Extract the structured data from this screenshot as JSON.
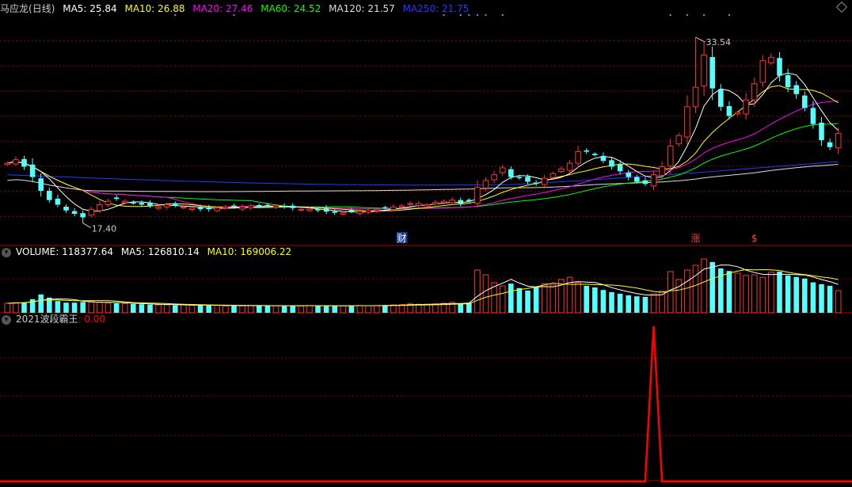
{
  "colors": {
    "up": "#ff3232",
    "down": "#54ffff",
    "grid": "#8b0000",
    "ma5": "#ffffff",
    "ma10": "#ffff00",
    "ma20": "#ff00ff",
    "ma60": "#00ff00",
    "ma120": "#dddddd",
    "ma250": "#1e3cff",
    "ind": "#ff0000",
    "label": "#cccccc"
  },
  "price_panel": {
    "stock_name": "马应龙",
    "period": "(日线)",
    "ma5": "MA5: 25.84",
    "ma10": "MA10: 26.88",
    "ma20": "MA20: 27.46",
    "ma60": "MA60: 24.52",
    "ma120": "MA120: 21.57",
    "ma250": "MA250: 21.75",
    "high_label": "33.54",
    "low_label": "17.40",
    "marker_cai": "财",
    "marker_zhang": "涨",
    "marker_dollar": "$"
  },
  "volume_panel": {
    "volume": "VOLUME: 118377.64",
    "ma5": "MA5: 126810.14",
    "ma10": "MA10: 169006.22"
  },
  "indicator_panel": {
    "name": "2021波段霸王",
    "value": ": 0.00"
  },
  "chart_data": [
    {
      "type": "candlestick",
      "title": "马应龙(日线)",
      "ylim": [
        15.8,
        35.4
      ],
      "y_log": false,
      "grid": true,
      "count": 100,
      "min_point": {
        "index": 9,
        "value": 17.4
      },
      "max_point": {
        "index": 82,
        "value": 33.54
      },
      "closes": [
        22.6,
        22.9,
        22.3,
        21.4,
        20.2,
        19.4,
        19.0,
        18.5,
        18.2,
        17.9,
        18.6,
        19.0,
        19.3,
        19.5,
        19.3,
        19.1,
        19.0,
        18.9,
        18.8,
        19.0,
        18.9,
        18.8,
        18.7,
        18.6,
        18.6,
        18.7,
        18.8,
        18.8,
        18.8,
        18.9,
        18.8,
        18.9,
        18.9,
        18.8,
        18.7,
        18.6,
        18.6,
        18.5,
        18.4,
        18.3,
        18.3,
        18.4,
        18.4,
        18.5,
        18.6,
        18.7,
        18.8,
        18.9,
        19.1,
        19.1,
        19.0,
        19.2,
        19.3,
        19.4,
        19.1,
        19.3,
        20.5,
        21.1,
        21.6,
        22.2,
        21.4,
        21.3,
        21.0,
        20.8,
        21.3,
        21.7,
        22.1,
        22.6,
        23.6,
        23.6,
        23.3,
        22.8,
        22.3,
        21.9,
        21.4,
        21.0,
        20.8,
        21.6,
        22.3,
        24.1,
        25.0,
        27.5,
        29.2,
        32.0,
        29.1,
        27.5,
        26.7,
        27.0,
        28.1,
        29.5,
        31.5,
        31.8,
        30.2,
        29.2,
        28.6,
        27.4,
        26.0,
        24.6,
        24.0,
        25.2
      ],
      "annotations": [
        "财",
        "涨",
        "$"
      ]
    },
    {
      "type": "volume",
      "title": "VOLUME",
      "count": 100,
      "values": [
        30,
        32,
        33,
        43,
        58,
        48,
        37,
        32,
        32,
        34,
        36,
        33,
        31,
        30,
        29,
        28,
        27,
        26,
        25,
        25,
        24,
        25,
        24,
        24,
        23,
        23,
        22,
        23,
        22,
        23,
        22,
        22,
        22,
        22,
        23,
        22,
        23,
        22,
        22,
        22,
        22,
        23,
        23,
        22,
        23,
        24,
        25,
        26,
        28,
        27,
        27,
        28,
        30,
        33,
        30,
        32,
        135,
        120,
        95,
        85,
        92,
        78,
        70,
        82,
        92,
        88,
        105,
        112,
        95,
        85,
        80,
        72,
        65,
        60,
        55,
        52,
        50,
        60,
        68,
        130,
        105,
        135,
        150,
        170,
        160,
        140,
        132,
        125,
        118,
        120,
        112,
        128,
        130,
        118,
        113,
        108,
        96,
        90,
        85,
        70
      ]
    },
    {
      "type": "line",
      "title": "2021波段霸王",
      "count": 100,
      "values": "0 everywhere except a single spike to 1 at index 77"
    }
  ]
}
